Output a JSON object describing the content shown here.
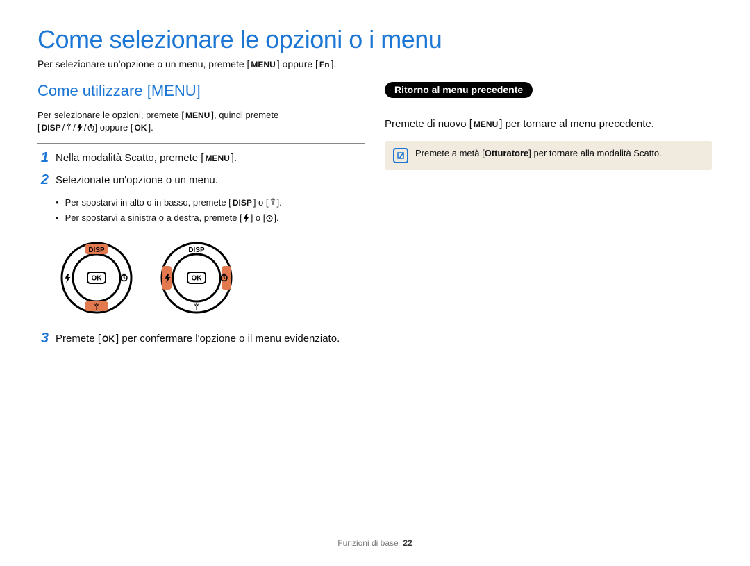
{
  "title": "Come selezionare le opzioni o i menu",
  "intro_pre": "Per selezionare un'opzione o un menu, premete [",
  "intro_mid": "] oppure [",
  "intro_end": "].",
  "labels": {
    "menu": "MENU",
    "fn": "Fn",
    "disp": "DISP",
    "ok": "OK",
    "shutter": "Otturatore"
  },
  "left": {
    "heading": "Come utilizzare [MENU]",
    "sub_pre": "Per selezionare le opzioni, premete [",
    "sub_post": "], quindi premete",
    "sub_line2_pre": "[",
    "sub_line2_mid": "] oppure [",
    "sub_line2_end": "].",
    "steps": [
      {
        "num": "1",
        "pre": "Nella modalità Scatto, premete [",
        "post": "]."
      },
      {
        "num": "2",
        "pre": "Selezionate un'opzione o un menu.",
        "post": ""
      },
      {
        "num": "3",
        "pre": "Premete [",
        "post": "] per confermare l'opzione o il menu evidenziato."
      }
    ],
    "bullets": [
      {
        "pre": "Per spostarvi in alto o in basso, premete [",
        "mid": "] o [",
        "end": "]."
      },
      {
        "pre": "Per spostarvi a sinistra o a destra, premete [",
        "mid": "] o [",
        "end": "]."
      }
    ]
  },
  "right": {
    "pill": "Ritorno al menu precedente",
    "text_pre": "Premete di nuovo [",
    "text_post": "] per tornare al menu precedente.",
    "note_pre": "Premete a metà [",
    "note_post": "] per tornare alla modalità Scatto."
  },
  "footer": {
    "section": "Funzioni di base",
    "page": "22"
  }
}
